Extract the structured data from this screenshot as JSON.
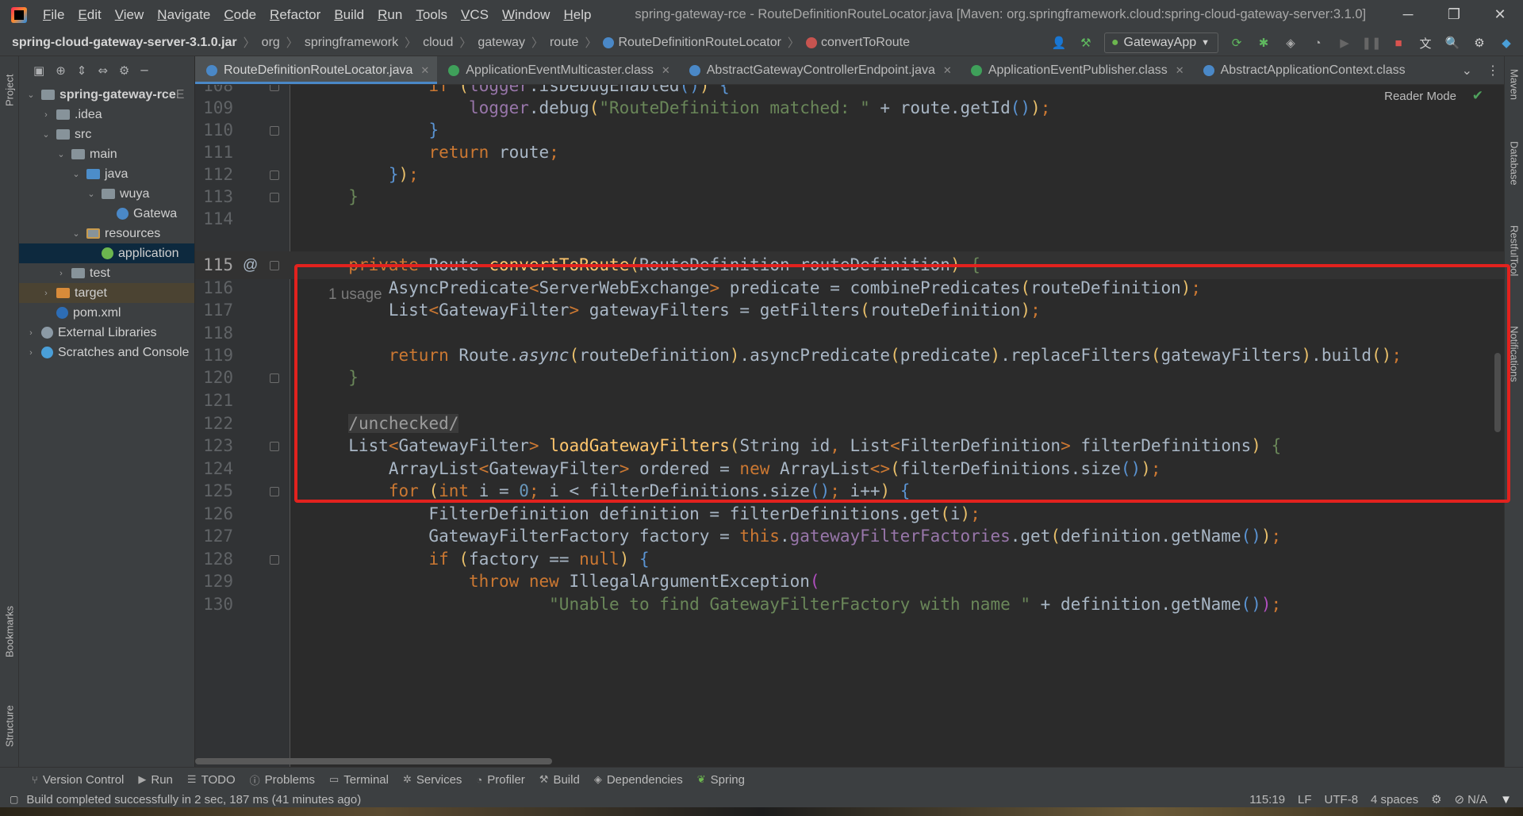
{
  "window": {
    "title": "spring-gateway-rce - RouteDefinitionRouteLocator.java [Maven: org.springframework.cloud:spring-cloud-gateway-server:3.1.0]",
    "menu": [
      "File",
      "Edit",
      "View",
      "Navigate",
      "Code",
      "Refactor",
      "Build",
      "Run",
      "Tools",
      "VCS",
      "Window",
      "Help"
    ],
    "controls": {
      "minimize": "─",
      "restore": "❐",
      "close": "✕"
    }
  },
  "breadcrumb": [
    "spring-cloud-gateway-server-3.1.0.jar",
    "org",
    "springframework",
    "cloud",
    "gateway",
    "route",
    "RouteDefinitionRouteLocator",
    "convertToRoute"
  ],
  "run_config": "GatewayApp",
  "project_tree": [
    {
      "label": "spring-gateway-rce",
      "suffix": "E",
      "indent": 0,
      "arrow": "▾",
      "icon": "folder"
    },
    {
      "label": ".idea",
      "indent": 1,
      "arrow": "▸",
      "icon": "folder"
    },
    {
      "label": "src",
      "indent": 1,
      "arrow": "▾",
      "icon": "folder"
    },
    {
      "label": "main",
      "indent": 2,
      "arrow": "▾",
      "icon": "folder"
    },
    {
      "label": "java",
      "indent": 3,
      "arrow": "▾",
      "icon": "folder-blue"
    },
    {
      "label": "wuya",
      "indent": 4,
      "arrow": "▾",
      "icon": "package"
    },
    {
      "label": "Gatewa",
      "indent": 5,
      "arrow": "",
      "icon": "spring-class"
    },
    {
      "label": "resources",
      "indent": 3,
      "arrow": "▾",
      "icon": "folder-res"
    },
    {
      "label": "application",
      "indent": 4,
      "arrow": "",
      "icon": "spring-config",
      "selected": true
    },
    {
      "label": "test",
      "indent": 2,
      "arrow": "▸",
      "icon": "folder"
    },
    {
      "label": "target",
      "indent": 1,
      "arrow": "▸",
      "icon": "folder-orange",
      "target": true
    },
    {
      "label": "pom.xml",
      "indent": 1,
      "arrow": "",
      "icon": "maven"
    },
    {
      "label": "External Libraries",
      "indent": 0,
      "arrow": "▸",
      "icon": "libraries"
    },
    {
      "label": "Scratches and Console",
      "indent": 0,
      "arrow": "▸",
      "icon": "scratches"
    }
  ],
  "left_tool_tabs": [
    "Project",
    "Bookmarks",
    "Structure"
  ],
  "right_tool_tabs": [
    "Maven",
    "Database",
    "RestfulTool",
    "Notifications"
  ],
  "tabs": [
    {
      "label": "RouteDefinitionRouteLocator.java",
      "active": true,
      "color": "#4a88c7"
    },
    {
      "label": "ApplicationEventMulticaster.class",
      "active": false,
      "color": "#3fa05a"
    },
    {
      "label": "AbstractGatewayControllerEndpoint.java",
      "active": false,
      "color": "#4a88c7"
    },
    {
      "label": "ApplicationEventPublisher.class",
      "active": false,
      "color": "#3fa05a"
    },
    {
      "label": "AbstractApplicationContext.class",
      "active": false,
      "color": "#4a88c7"
    }
  ],
  "editor": {
    "reader_mode": "Reader Mode",
    "usage_hint": "1 usage",
    "current_line": 115,
    "lines": [
      {
        "n": "108"
      },
      {
        "n": "109"
      },
      {
        "n": "110"
      },
      {
        "n": "111"
      },
      {
        "n": "112"
      },
      {
        "n": "113"
      },
      {
        "n": "114"
      },
      {
        "n": "115"
      },
      {
        "n": "116"
      },
      {
        "n": "117"
      },
      {
        "n": "118"
      },
      {
        "n": "119"
      },
      {
        "n": "120"
      },
      {
        "n": "121"
      },
      {
        "n": "122"
      },
      {
        "n": "123"
      },
      {
        "n": "124"
      },
      {
        "n": "125"
      },
      {
        "n": "126"
      },
      {
        "n": "127"
      },
      {
        "n": "128"
      },
      {
        "n": "129"
      },
      {
        "n": "130"
      }
    ]
  },
  "bottom_tools": [
    "Version Control",
    "Run",
    "TODO",
    "Problems",
    "Terminal",
    "Services",
    "Profiler",
    "Build",
    "Dependencies",
    "Spring"
  ],
  "status": {
    "message": "Build completed successfully in 2 sec, 187 ms (41 minutes ago)",
    "position": "115:19",
    "line_sep": "LF",
    "encoding": "UTF-8",
    "indent": "4 spaces",
    "na": "N/A"
  },
  "colors": {
    "highlight_box": "#e2221e",
    "keyword": "#cc7832",
    "function": "#ffc66d",
    "string": "#6a8759"
  }
}
